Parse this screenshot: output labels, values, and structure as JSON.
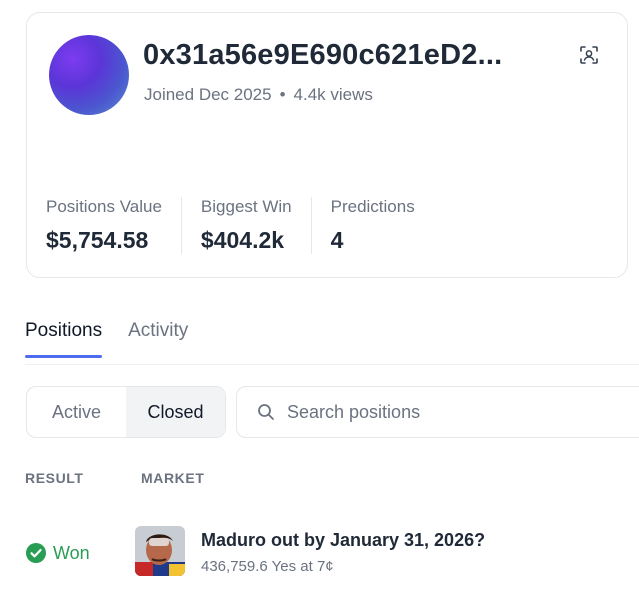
{
  "profile": {
    "address": "0x31a56e9E690c621eD2...",
    "joined": "Joined Dec 2025",
    "views": "4.4k views",
    "separator": "•"
  },
  "stats": [
    {
      "label": "Positions Value",
      "value": "$5,754.58"
    },
    {
      "label": "Biggest Win",
      "value": "$404.2k"
    },
    {
      "label": "Predictions",
      "value": "4"
    }
  ],
  "tabs": [
    {
      "label": "Positions",
      "active": true
    },
    {
      "label": "Activity",
      "active": false
    }
  ],
  "filter": {
    "options": [
      "Active",
      "Closed"
    ],
    "selected": "Closed"
  },
  "search": {
    "placeholder": "Search positions",
    "value": ""
  },
  "table": {
    "columns": [
      "RESULT",
      "MARKET"
    ],
    "rows": [
      {
        "result": "Won",
        "market_title": "Maduro out by January 31, 2026?",
        "market_detail": "436,759.6 Yes at 7¢"
      }
    ]
  },
  "colors": {
    "accent": "#4f6cf0",
    "won": "#2a9d55",
    "muted_text": "#6b7280",
    "primary_text": "#1f2937"
  },
  "icons": {
    "qr": "qr-scan-icon",
    "search": "search-icon",
    "won": "check-circle-icon"
  }
}
